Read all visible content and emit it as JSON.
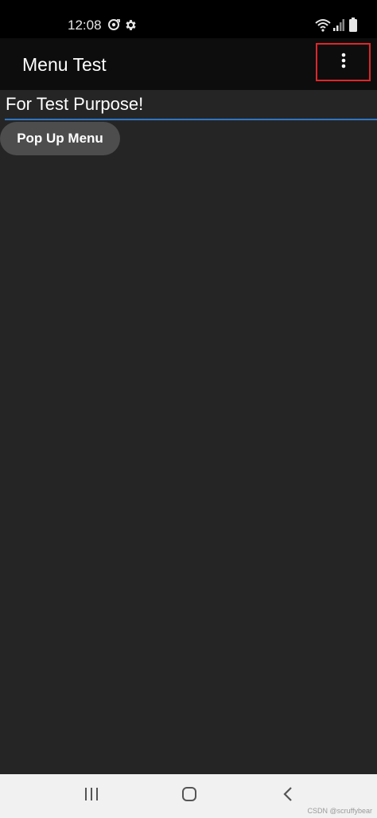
{
  "status_bar": {
    "time": "12:08",
    "icons": [
      "sync-icon",
      "gear-icon",
      "wifi-icon",
      "signal-icon",
      "battery-icon"
    ]
  },
  "app_bar": {
    "title": "Menu Test",
    "overflow_icon": "more-vert-icon",
    "highlight_color": "#e0262a"
  },
  "main": {
    "edit_text": "For Test Purpose!",
    "underline_color": "#2f77c4",
    "popup_button_label": "Pop Up Menu"
  },
  "nav_bar": {
    "buttons": [
      "recents-icon",
      "home-icon",
      "back-icon"
    ],
    "watermark": "CSDN @scruffybear"
  }
}
